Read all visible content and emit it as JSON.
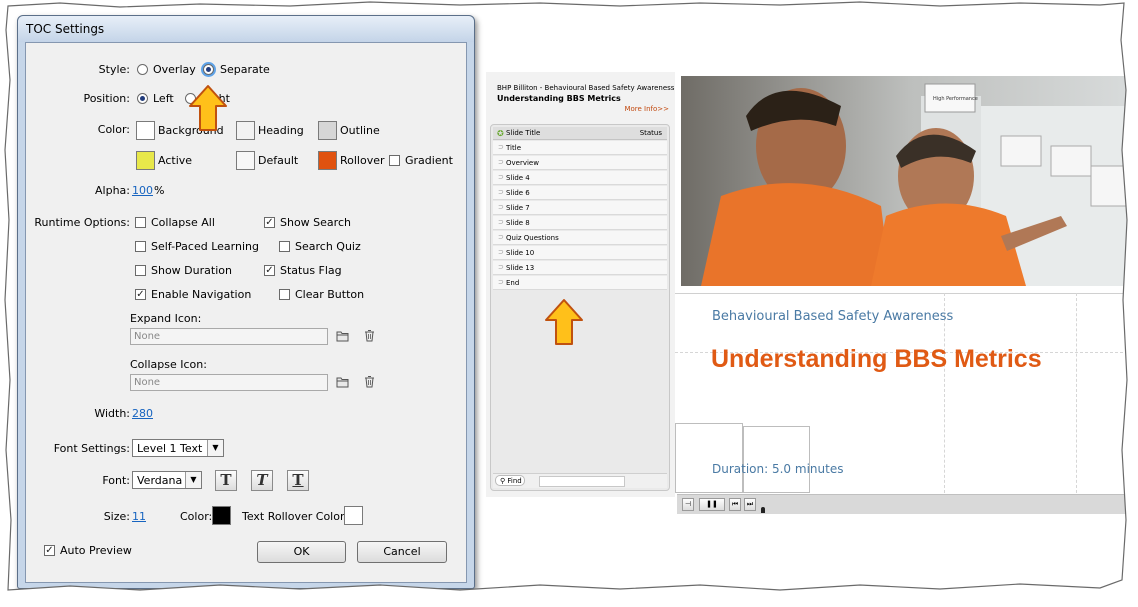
{
  "dialog": {
    "title": "TOC Settings",
    "style_label": "Style:",
    "style_options": [
      {
        "label": "Overlay",
        "selected": false
      },
      {
        "label": "Separate",
        "selected": true
      }
    ],
    "position_label": "Position:",
    "position_options": [
      {
        "label": "Left",
        "selected": true
      },
      {
        "label": "Right",
        "selected": false
      }
    ],
    "color_label": "Color:",
    "colors": [
      {
        "label": "Background",
        "hex": "#ffffff"
      },
      {
        "label": "Heading",
        "hex": "#f2f2f2"
      },
      {
        "label": "Outline",
        "hex": "#d6d6d6"
      },
      {
        "label": "Active",
        "hex": "#e8e84a"
      },
      {
        "label": "Default",
        "hex": "#f7f7f7"
      },
      {
        "label": "Rollover",
        "hex": "#e0520f"
      }
    ],
    "gradient_label": "Gradient",
    "gradient_checked": false,
    "alpha_label": "Alpha:",
    "alpha_value": "100",
    "alpha_unit": "%",
    "runtime_label": "Runtime Options:",
    "runtime_options": [
      {
        "label": "Collapse All",
        "checked": false
      },
      {
        "label": "Show Search",
        "checked": true
      },
      {
        "label": "Self-Paced Learning",
        "checked": false
      },
      {
        "label": "Search Quiz",
        "checked": false
      },
      {
        "label": "Show Duration",
        "checked": false
      },
      {
        "label": "Status Flag",
        "checked": true
      },
      {
        "label": "Enable Navigation",
        "checked": true
      },
      {
        "label": "Clear Button",
        "checked": false
      }
    ],
    "expand_icon_label": "Expand Icon:",
    "expand_icon_value": "None",
    "collapse_icon_label": "Collapse Icon:",
    "collapse_icon_value": "None",
    "width_label": "Width:",
    "width_value": "280",
    "font_settings_label": "Font Settings:",
    "font_settings_value": "Level 1 Text",
    "font_label": "Font:",
    "font_value": "Verdana",
    "font_style_buttons": [
      "T",
      "T",
      "T"
    ],
    "size_label": "Size:",
    "size_value": "11",
    "text_color_label": "Color:",
    "text_color_hex": "#000000",
    "rollover_color_label": "Text Rollover Color:",
    "rollover_color_hex": "#ffffff",
    "auto_preview_label": "Auto Preview",
    "auto_preview_checked": true,
    "ok_label": "OK",
    "cancel_label": "Cancel"
  },
  "toc": {
    "project": "BHP Billiton - Behavioural Based Safety Awareness",
    "title": "Understanding BBS Metrics",
    "more_info": "More Info>>",
    "col_title": "Slide Title",
    "col_status": "Status",
    "items": [
      "Title",
      "Overview",
      "Slide 4",
      "Slide 6",
      "Slide 7",
      "Slide 8",
      "Quiz Questions",
      "Slide 10",
      "Slide 13",
      "End"
    ],
    "find_label": "Find"
  },
  "slide": {
    "photo_sign": "High Performance",
    "subtitle": "Behavioural Based Safety Awareness",
    "title": "Understanding BBS Metrics",
    "duration": "Duration: 5.0 minutes"
  },
  "colors": {
    "accent_orange": "#e05a14",
    "link_blue": "#1764c0",
    "callout_yellow": "#ffc01a"
  }
}
